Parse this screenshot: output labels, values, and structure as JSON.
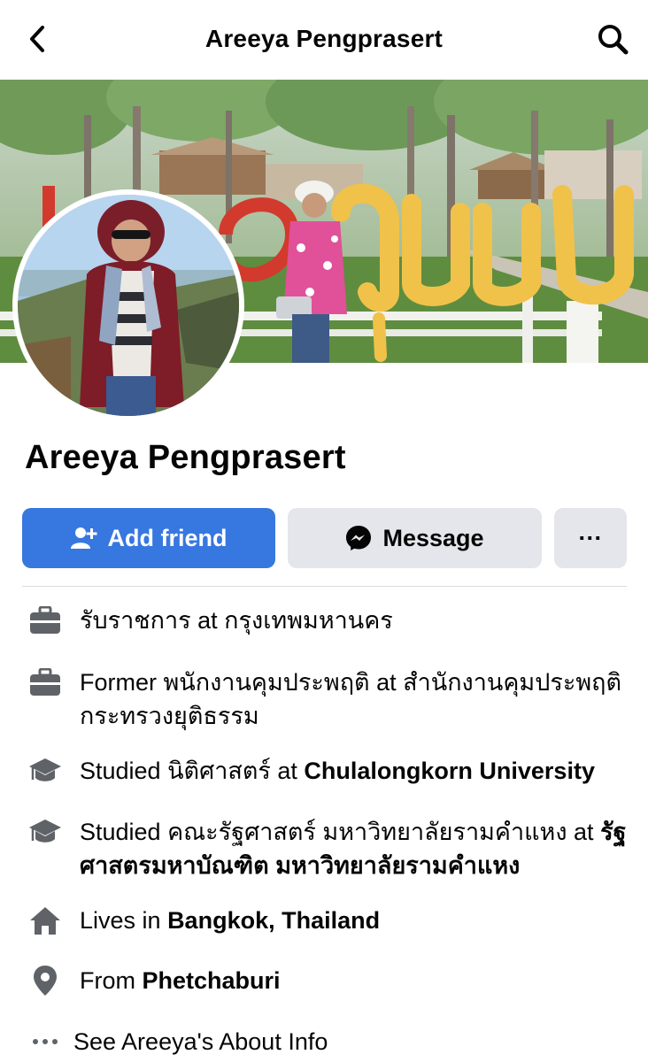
{
  "header": {
    "title": "Areeya Pengprasert",
    "back_icon": "chevron-left-icon",
    "search_icon": "search-icon"
  },
  "profile": {
    "name": "Areeya Pengprasert"
  },
  "actions": {
    "add_friend_label": "Add friend",
    "message_label": "Message",
    "more_label": "···",
    "accent": "#3777e0"
  },
  "intro": {
    "work": [
      {
        "icon": "briefcase-icon",
        "prefix": "รับราชการ at ",
        "place": "กรุงเทพมหานคร"
      },
      {
        "icon": "briefcase-icon",
        "prefix": "Former พนักงานคุมประพฤติ at ",
        "place": "สำนักงานคุมประพฤติ กระทรวงยุติธรรม"
      }
    ],
    "education": [
      {
        "icon": "graduation-cap-icon",
        "prefix": "Studied นิติศาสตร์ at ",
        "school": "Chulalongkorn University"
      },
      {
        "icon": "graduation-cap-icon",
        "prefix": "Studied คณะรัฐศาสตร์ มหาวิทยาลัยรามคำแหง at ",
        "school": "รัฐศาสตรมหาบัณฑิต มหาวิทยาลัยรามคำแหง"
      }
    ],
    "lives": {
      "icon": "home-icon",
      "prefix": "Lives in ",
      "place": "Bangkok, Thailand"
    },
    "from": {
      "icon": "location-pin-icon",
      "prefix": "From ",
      "place": "Phetchaburi"
    },
    "see_more": {
      "icon": "ellipsis-icon",
      "label": "See Areeya's About Info"
    }
  }
}
